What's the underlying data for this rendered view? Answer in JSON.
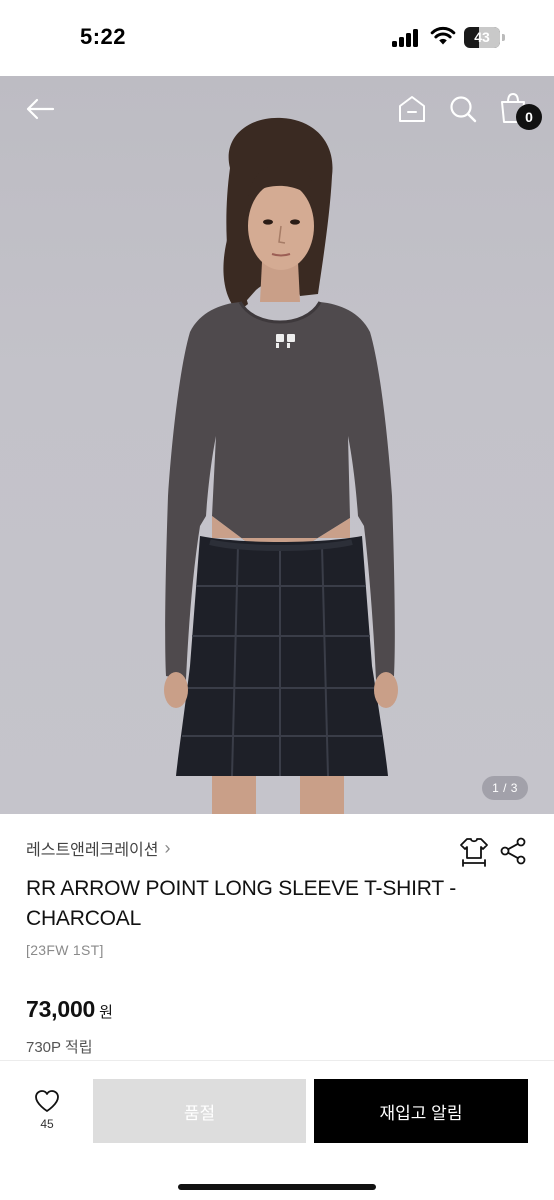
{
  "status_bar": {
    "time": "5:22",
    "battery_level": "43"
  },
  "header": {
    "back_icon": "arrow-left-icon",
    "home_icon": "home-icon",
    "search_icon": "search-icon",
    "bag_icon": "shopping-bag-icon",
    "bag_count": "0"
  },
  "gallery": {
    "indicator": "1 / 3"
  },
  "product": {
    "brand": "레스트앤레크레이션",
    "brand_chevron": "›",
    "title": "RR ARROW POINT LONG SLEEVE T-SHIRT - CHARCOAL",
    "tag": "[23FW 1ST]",
    "price": "73,000",
    "currency": "원",
    "points": "730P 적립"
  },
  "actions": {
    "like_count": "45",
    "soldout_label": "품절",
    "restock_label": "재입고 알림"
  },
  "colors": {
    "primary": "#000000",
    "disabled": "#dddddd",
    "text": "#111111",
    "muted": "#8a8a8a"
  }
}
